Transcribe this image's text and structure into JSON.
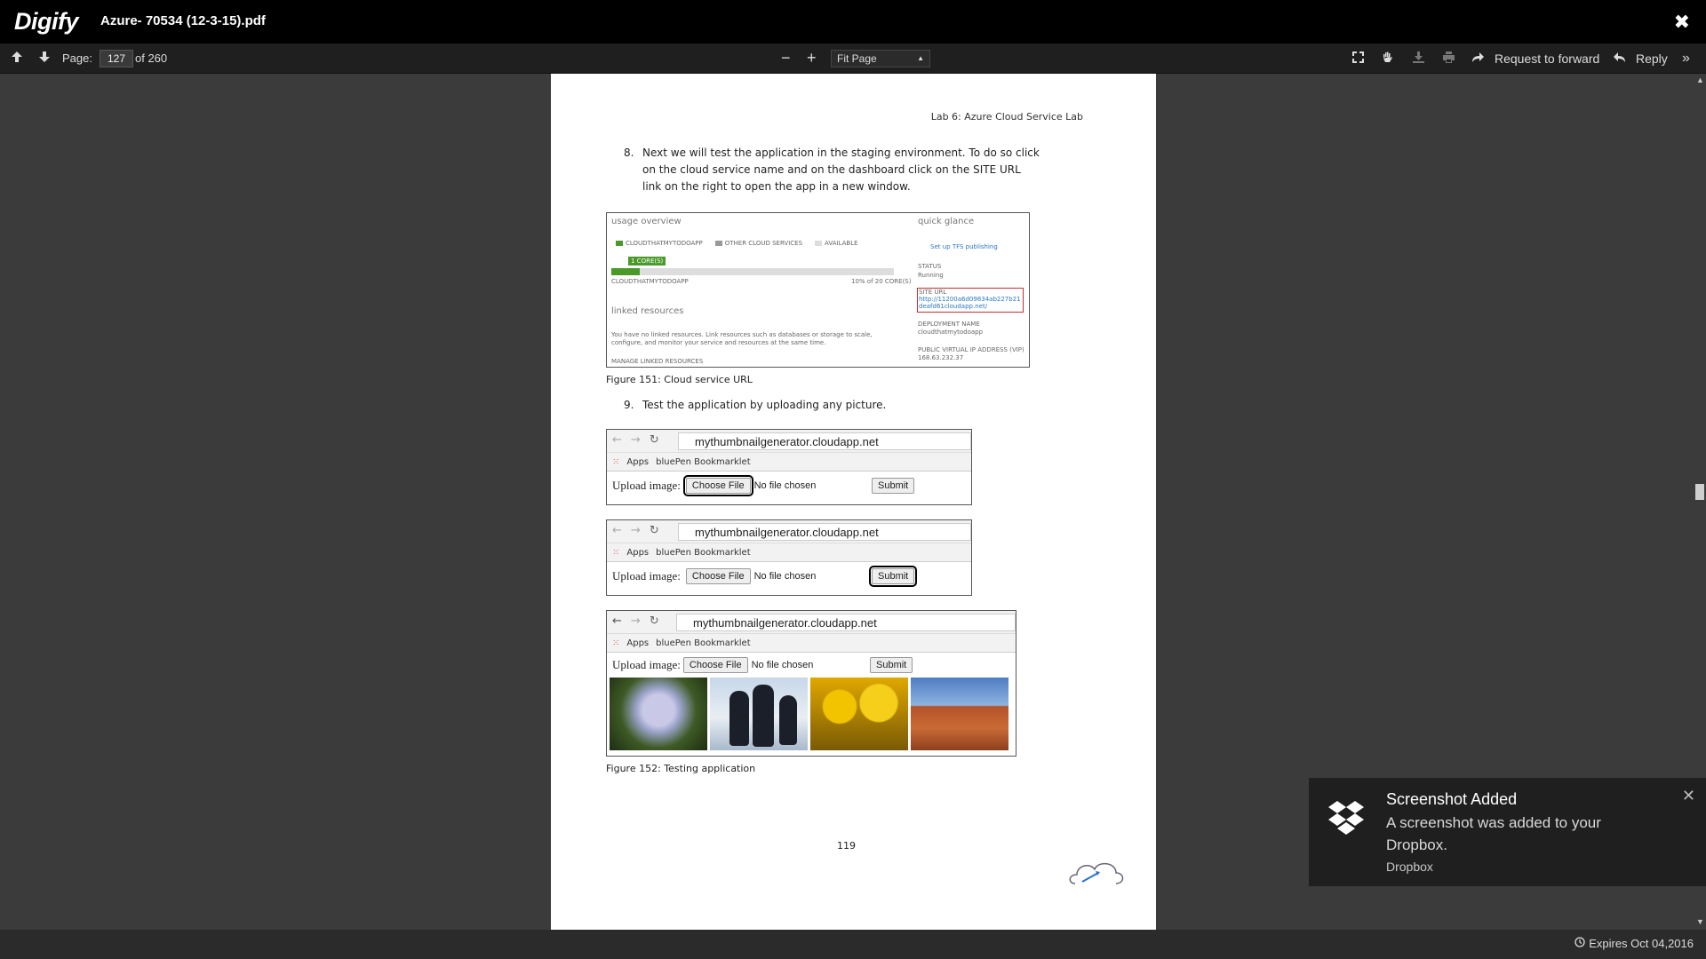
{
  "app": {
    "logo": "Digify",
    "document_title": "Azure- 70534 (12-3-15).pdf"
  },
  "toolbar": {
    "page_label": "Page:",
    "page_current": "127",
    "page_total": "of 260",
    "zoom_value": "Fit Page",
    "request_forward": "Request to forward",
    "reply": "Reply"
  },
  "page": {
    "header": "Lab 6: Azure Cloud Service Lab",
    "step8_num": "8.",
    "step8_text": "Next we will test the application in the staging environment. To do so click on the cloud service name and on the dashboard click on the SITE URL link on the right to open the app in a new window.",
    "fig151_caption": "Figure 151: Cloud service URL",
    "step9_num": "9.",
    "step9_text": "Test the application by uploading any picture.",
    "fig152_caption": "Figure 152: Testing application",
    "page_number": "119",
    "fig151": {
      "usage_title": "usage overview",
      "quick_title": "quick glance",
      "legend1": "CLOUDTHATMYTODOAPP",
      "legend2": "OTHER CLOUD SERVICES",
      "legend3": "AVAILABLE",
      "cores": "1 CORE(S)",
      "app_name": "CLOUDTHATMYTODOAPP",
      "cores_pct": "10% of 20 CORE(S)",
      "linked_title": "linked resources",
      "linked_text": "You have no linked resources. Link resources such as databases or storage to scale, configure, and monitor your service and resources at the same time.",
      "manage_linked": "MANAGE LINKED RESOURCES",
      "tfs": "Set up TFS publishing",
      "status_label": "STATUS",
      "status_value": "Running",
      "site_url_label": "SITE URL",
      "site_url_value": "http://11200a6d09834ab227b21deafd61cloudapp.net/",
      "deploy_label": "DEPLOYMENT NAME",
      "deploy_value": "cloudthatmytodoapp",
      "vip_label": "PUBLIC VIRTUAL IP ADDRESS (VIP)",
      "vip_value": "168.63.232.37"
    },
    "browser": {
      "url": "mythumbnailgenerator.cloudapp.net",
      "apps": "Apps",
      "bookmark": "bluePen Bookmarklet",
      "upload_label": "Upload image:",
      "choose_file": "Choose File",
      "no_file": "No file chosen",
      "submit": "Submit"
    }
  },
  "footer": {
    "expires": "Expires Oct 04,2016"
  },
  "notification": {
    "title": "Screenshot Added",
    "body": "A screenshot was added to your Dropbox.",
    "source": "Dropbox"
  }
}
